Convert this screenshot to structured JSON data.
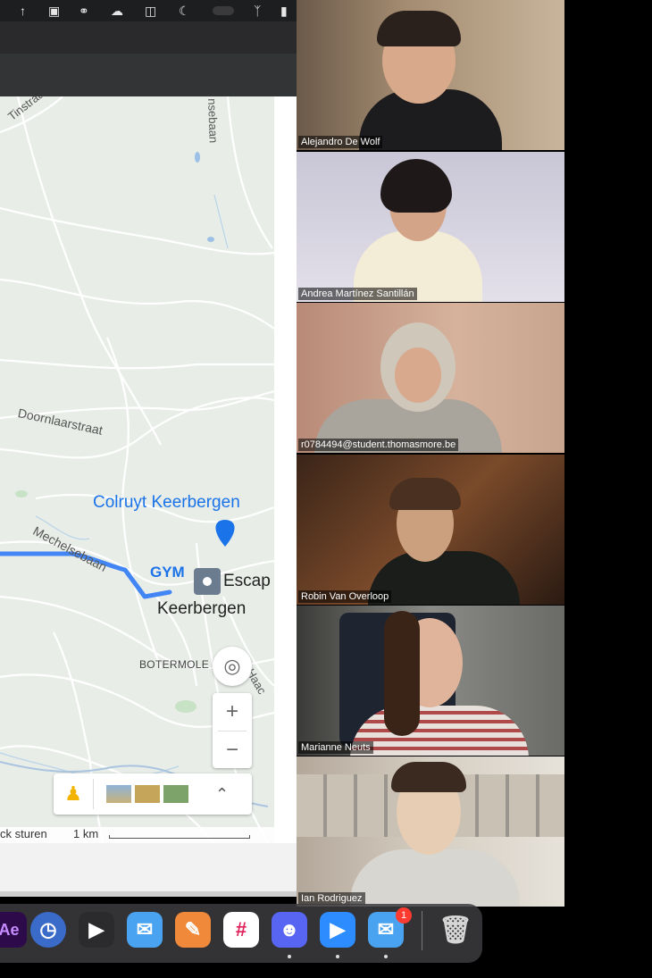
{
  "menubar": {
    "icons": [
      "caps-lock-icon",
      "network-icon",
      "glasses-icon",
      "cloud-icon",
      "mirror-icon",
      "moon-icon",
      "bluetooth-icon",
      "battery-icon"
    ]
  },
  "map": {
    "streets": {
      "tinstraat": "Tinstraat",
      "nsebaan": "nsebaan",
      "doornlaarstraat": "Doornlaarstraat",
      "mechelsebaan": "Mechelsebaan",
      "haac": "Haac"
    },
    "places": {
      "colruyt": "Colruyt Keerbergen",
      "gym": "GYM",
      "escap": "Escap",
      "keerbergen": "Keerbergen",
      "botermole": "BOTERMOLE"
    },
    "controls": {
      "zoom_in": "+",
      "zoom_out": "−",
      "layers_toggle": "⌃"
    },
    "footer": {
      "feedback": "ck sturen",
      "scale": "1 km"
    },
    "colors": {
      "route": "#4285f4",
      "poi": "#1a73e8",
      "land": "#e8ede8"
    }
  },
  "participants": [
    {
      "name": "Alejandro De Wolf"
    },
    {
      "name": "Andrea Martínez Santillán"
    },
    {
      "name": "r0784494@student.thomasmore.be"
    },
    {
      "name": "Robin Van Overloop"
    },
    {
      "name": "Marianne Neuts"
    },
    {
      "name": "Ian Rodriguez"
    }
  ],
  "dock": {
    "apps": [
      {
        "name": "after-effects-icon",
        "label": "Ae"
      },
      {
        "name": "clock-icon",
        "label": ""
      },
      {
        "name": "voice-icon",
        "label": ""
      },
      {
        "name": "mail-icon",
        "label": ""
      },
      {
        "name": "pen-icon",
        "label": ""
      },
      {
        "name": "slack-icon",
        "label": ""
      },
      {
        "name": "discord-icon",
        "label": ""
      },
      {
        "name": "zoom-icon",
        "label": ""
      },
      {
        "name": "mail-alt-icon",
        "label": ""
      },
      {
        "name": "trash-icon",
        "label": ""
      }
    ],
    "badge": "1"
  }
}
